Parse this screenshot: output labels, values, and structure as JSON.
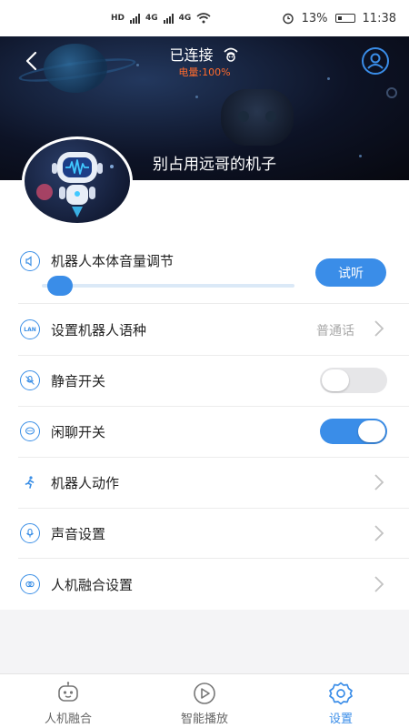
{
  "status_bar": {
    "network_labels": [
      "HD",
      "4G",
      "4G"
    ],
    "battery": "13%",
    "time": "11:38"
  },
  "header": {
    "title": "已连接",
    "battery_level": "电量:100%",
    "robot_name": "别占用远哥的机子"
  },
  "settings": {
    "volume_label": "机器人本体音量调节",
    "listen_button": "试听",
    "volume_level": 0.04,
    "language_label": "设置机器人语种",
    "language_value": "普通话",
    "mute_label": "静音开关",
    "mute_on": false,
    "chat_label": "闲聊开关",
    "chat_on": true,
    "action_label": "机器人动作",
    "sound_label": "声音设置",
    "fusion_label": "人机融合设置"
  },
  "bottom_nav": {
    "items": [
      {
        "label": "人机融合",
        "icon": "robot-face-icon"
      },
      {
        "label": "智能播放",
        "icon": "play-circle-icon"
      },
      {
        "label": "设置",
        "icon": "gear-icon"
      }
    ],
    "active_index": 2
  },
  "colors": {
    "accent": "#3a8de8",
    "battery_text": "#ff6b2d"
  }
}
